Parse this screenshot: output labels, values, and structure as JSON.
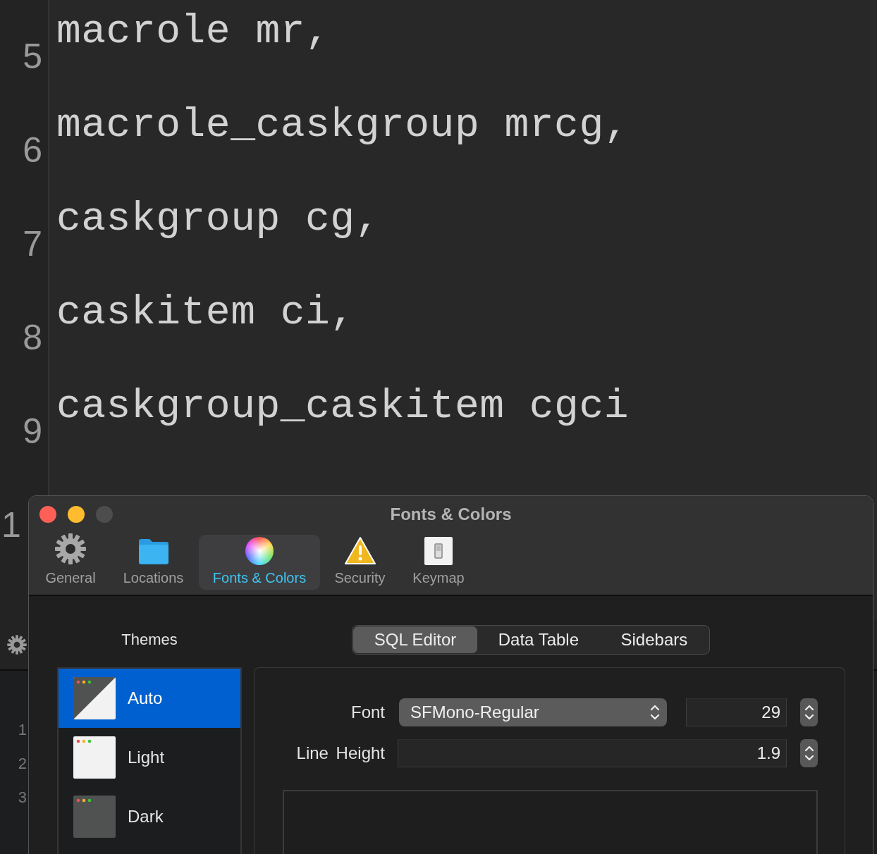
{
  "editor": {
    "lines": [
      {
        "number": "5",
        "code": "macrole mr,"
      },
      {
        "number": "6",
        "code": "macrole_caskgroup mrcg,"
      },
      {
        "number": "7",
        "code": "caskgroup cg,"
      },
      {
        "number": "8",
        "code": "caskitem ci,"
      },
      {
        "number": "9",
        "code": "caskgroup_caskitem cgci"
      }
    ],
    "partial_number": "1"
  },
  "results": {
    "line_numbers": [
      "1",
      "2",
      "3"
    ]
  },
  "dialog": {
    "title": "Fonts & Colors",
    "window_controls": [
      {
        "kind": "close",
        "disabled": false
      },
      {
        "kind": "minimize",
        "disabled": false
      },
      {
        "kind": "zoom",
        "disabled": true
      }
    ],
    "toolbar": [
      {
        "label": "General",
        "kind": "gear",
        "selected": false
      },
      {
        "label": "Locations",
        "kind": "folder",
        "selected": false
      },
      {
        "label": "Fonts & Colors",
        "kind": "colors",
        "selected": true
      },
      {
        "label": "Security",
        "kind": "warning",
        "selected": false
      },
      {
        "label": "Keymap",
        "kind": "switch",
        "selected": false
      }
    ],
    "themes_label": "Themes",
    "segments": [
      {
        "label": "SQL Editor",
        "selected": true
      },
      {
        "label": "Data Table",
        "selected": false
      },
      {
        "label": "Sidebars",
        "selected": false
      }
    ],
    "themes": [
      {
        "label": "Auto",
        "kind": "auto",
        "selected": true
      },
      {
        "label": "Light",
        "kind": "light",
        "selected": false
      },
      {
        "label": "Dark",
        "kind": "dark",
        "selected": false
      }
    ],
    "font": {
      "label": "Font",
      "value": "SFMono-Regular",
      "size": "29"
    },
    "line_height": {
      "label": "Line Height",
      "value": "1.9"
    }
  }
}
